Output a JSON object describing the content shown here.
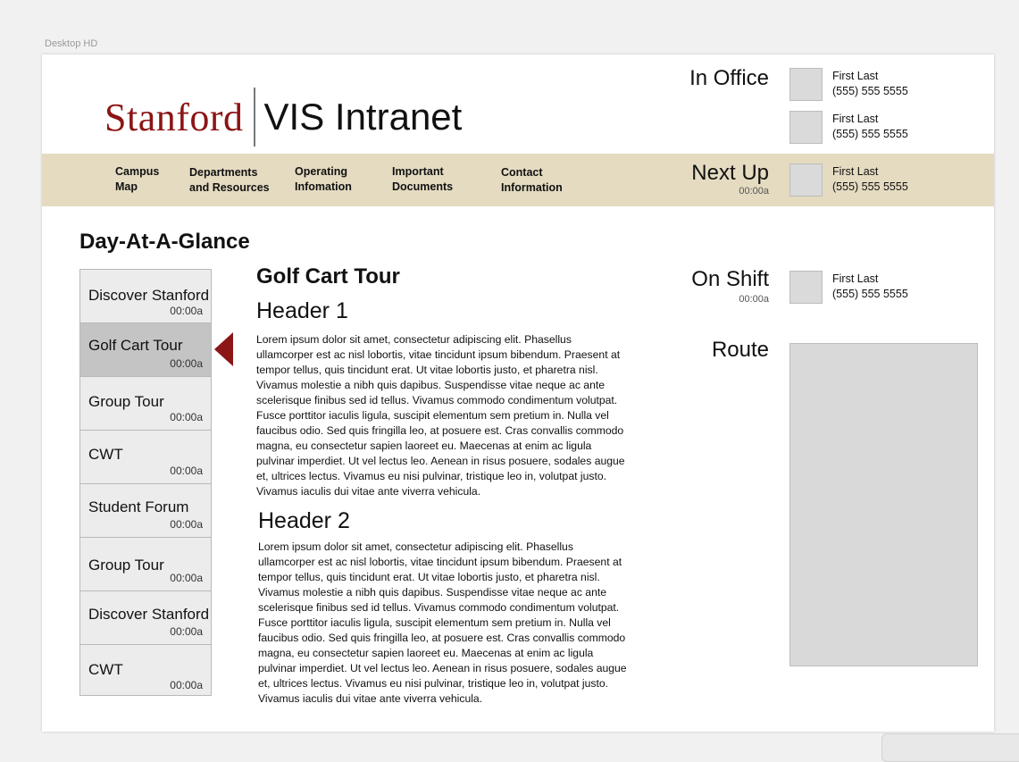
{
  "artboard_label": "Desktop HD",
  "brand": {
    "stanford": "Stanford",
    "intranet": "VIS Intranet",
    "brand_color": "#8c1515"
  },
  "nav": [
    {
      "line1": "Campus",
      "line2": "Map"
    },
    {
      "line1": "Departments",
      "line2": "and Resources"
    },
    {
      "line1": "Operating",
      "line2": "Infomation"
    },
    {
      "line1": "Important",
      "line2": "Documents"
    },
    {
      "line1": "Contact",
      "line2": "Information"
    }
  ],
  "in_office": {
    "label": "In Office",
    "people": [
      {
        "name": "First Last",
        "phone": "(555) 555 5555"
      },
      {
        "name": "First Last",
        "phone": "(555) 555 5555"
      }
    ]
  },
  "next_up": {
    "label": "Next Up",
    "time": "00:00a",
    "person": {
      "name": "First Last",
      "phone": "(555) 555 5555"
    }
  },
  "on_shift": {
    "label": "On Shift",
    "time": "00:00a",
    "person": {
      "name": "First Last",
      "phone": "(555) 555 5555"
    }
  },
  "route": {
    "label": "Route"
  },
  "day_at_a_glance": {
    "title": "Day-At-A-Glance",
    "items": [
      {
        "name": "Discover Stanford",
        "time": "00:00a"
      },
      {
        "name": "Golf Cart Tour",
        "time": "00:00a"
      },
      {
        "name": "Group Tour",
        "time": "00:00a"
      },
      {
        "name": "CWT",
        "time": "00:00a"
      },
      {
        "name": "Student Forum",
        "time": "00:00a"
      },
      {
        "name": "Group Tour",
        "time": "00:00a"
      },
      {
        "name": "Discover Stanford",
        "time": "00:00a"
      },
      {
        "name": "CWT",
        "time": "00:00a"
      }
    ]
  },
  "content": {
    "title": "Golf Cart Tour",
    "header1": "Header 1",
    "paragraph1": "Lorem ipsum dolor sit amet, consectetur adipiscing elit. Phasellus ullamcorper est ac nisl lobortis, vitae tincidunt ipsum bibendum. Praesent at tempor tellus, quis tincidunt erat. Ut vitae lobortis justo, et pharetra nisl. Vivamus molestie a nibh quis dapibus. Suspendisse vitae neque ac ante scelerisque finibus sed id tellus. Vivamus commodo condimentum volutpat. Fusce porttitor iaculis ligula, suscipit elementum sem pretium in. Nulla vel faucibus odio. Sed quis fringilla leo, at posuere est. Cras convallis commodo magna, eu consectetur sapien laoreet eu. Maecenas at enim ac ligula pulvinar imperdiet. Ut vel lectus leo. Aenean in risus posuere, sodales augue et, ultrices lectus. Vivamus eu nisi pulvinar, tristique leo in, volutpat justo. Vivamus iaculis dui vitae ante viverra vehicula.",
    "header2": "Header 2",
    "paragraph2": "Lorem ipsum dolor sit amet, consectetur adipiscing elit. Phasellus ullamcorper est ac nisl lobortis, vitae tincidunt ipsum bibendum. Praesent at tempor tellus, quis tincidunt erat. Ut vitae lobortis justo, et pharetra nisl. Vivamus molestie a nibh quis dapibus. Suspendisse vitae neque ac ante scelerisque finibus sed id tellus. Vivamus commodo condimentum volutpat. Fusce porttitor iaculis ligula, suscipit elementum sem pretium in. Nulla vel faucibus odio. Sed quis fringilla leo, at posuere est. Cras convallis commodo magna, eu consectetur sapien laoreet eu. Maecenas at enim ac ligula pulvinar imperdiet. Ut vel lectus leo. Aenean in risus posuere, sodales augue et, ultrices lectus. Vivamus eu nisi pulvinar, tristique leo in, volutpat justo. Vivamus iaculis dui vitae ante viverra vehicula."
  }
}
